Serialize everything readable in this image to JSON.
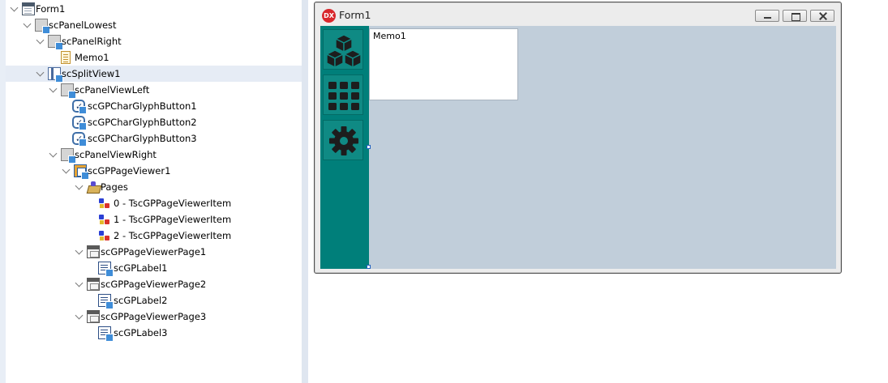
{
  "structure_tree": {
    "nodes": [
      {
        "label": "Form1",
        "icon": "form-icon",
        "expanded": true
      },
      {
        "label": "scPanelLowest",
        "icon": "panel-icon",
        "expanded": true
      },
      {
        "label": "scPanelRight",
        "icon": "panel-icon",
        "expanded": true
      },
      {
        "label": "Memo1",
        "icon": "memo-icon"
      },
      {
        "label": "scSplitView1",
        "icon": "split-view-icon",
        "expanded": true,
        "selected": true
      },
      {
        "label": "scPanelViewLeft",
        "icon": "panel-icon",
        "expanded": true
      },
      {
        "label": "scGPCharGlyphButton1",
        "icon": "glyph-button-icon"
      },
      {
        "label": "scGPCharGlyphButton2",
        "icon": "glyph-button-icon"
      },
      {
        "label": "scGPCharGlyphButton3",
        "icon": "glyph-button-icon"
      },
      {
        "label": "scPanelViewRight",
        "icon": "panel-icon",
        "expanded": true
      },
      {
        "label": "scGPPageViewer1",
        "icon": "page-viewer-icon",
        "expanded": true
      },
      {
        "label": "Pages",
        "icon": "pages-collection-icon",
        "expanded": true
      },
      {
        "label": "0 - TscGPPageViewerItem",
        "icon": "page-item-icon"
      },
      {
        "label": "1 - TscGPPageViewerItem",
        "icon": "page-item-icon"
      },
      {
        "label": "2 - TscGPPageViewerItem",
        "icon": "page-item-icon"
      },
      {
        "label": "scGPPageViewerPage1",
        "icon": "page-icon",
        "expanded": true
      },
      {
        "label": "scGPLabel1",
        "icon": "label-icon"
      },
      {
        "label": "scGPPageViewerPage2",
        "icon": "page-icon",
        "expanded": true
      },
      {
        "label": "scGPLabel2",
        "icon": "label-icon"
      },
      {
        "label": "scGPPageViewerPage3",
        "icon": "page-icon",
        "expanded": true
      },
      {
        "label": "scGPLabel3",
        "icon": "label-icon"
      }
    ]
  },
  "form": {
    "title": "Form1",
    "logo_text": "DX",
    "memo_text": "Memo1",
    "sidebar_buttons": [
      {
        "icon": "cubes-icon"
      },
      {
        "icon": "grid-icon"
      },
      {
        "icon": "gear-icon"
      }
    ]
  },
  "colors": {
    "sidebar": "#007f7a",
    "client": "#c1ceda",
    "selection": "#e6ecf5",
    "logo": "#d8272c"
  }
}
